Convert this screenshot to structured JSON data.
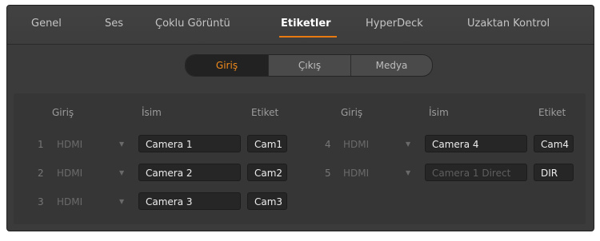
{
  "tabs": [
    {
      "label": "Genel"
    },
    {
      "label": "Ses"
    },
    {
      "label": "Çoklu Görüntü"
    },
    {
      "label": "Etiketler"
    },
    {
      "label": "HyperDeck"
    },
    {
      "label": "Uzaktan Kontrol"
    }
  ],
  "active_tab": "Etiketler",
  "segments": [
    {
      "label": "Giriş"
    },
    {
      "label": "Çıkış"
    },
    {
      "label": "Medya"
    }
  ],
  "active_segment": "Giriş",
  "headers": {
    "input": "Giriş",
    "name": "İsim",
    "label": "Etiket"
  },
  "rows": [
    {
      "number": "1",
      "source": "HDMI",
      "name": "Camera 1",
      "label": "Cam1"
    },
    {
      "number": "2",
      "source": "HDMI",
      "name": "Camera 2",
      "label": "Cam2"
    },
    {
      "number": "3",
      "source": "HDMI",
      "name": "Camera 3",
      "label": "Cam3"
    },
    {
      "number": "4",
      "source": "HDMI",
      "name": "Camera 4",
      "label": "Cam4"
    },
    {
      "number": "5",
      "source": "HDMI",
      "name": "Camera 1 Direct",
      "label": "DIR"
    }
  ],
  "colors": {
    "accent": "#e87a12",
    "panel": "#3b3b3b",
    "field": "#262626"
  }
}
